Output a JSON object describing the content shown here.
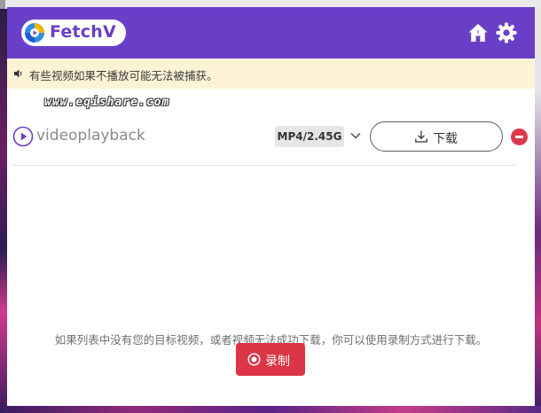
{
  "app": {
    "name": "FetchV",
    "brand_color": "#6a3fc8",
    "logo_icon": "fetchv-logo-icon"
  },
  "header": {
    "home_icon": "home-icon",
    "settings_icon": "gear-icon"
  },
  "notice": {
    "icon": "speaker-icon",
    "text": "有些视频如果不播放可能无法被捕获。",
    "background": "#fcf3d6"
  },
  "watermark": {
    "text": "www.eqishare.com"
  },
  "videos": [
    {
      "icon": "play-circle-icon",
      "name": "videoplayback",
      "format": "MP4/2.45G",
      "download_label": "下载",
      "download_icon": "download-icon",
      "remove_icon": "minus-circle-icon"
    }
  ],
  "footer": {
    "hint": "如果列表中没有您的目标视频，或者视频无法成功下载，你可以使用录制方式进行下载。",
    "record_label": "录制",
    "record_icon": "record-icon",
    "record_color": "#dc3545"
  }
}
